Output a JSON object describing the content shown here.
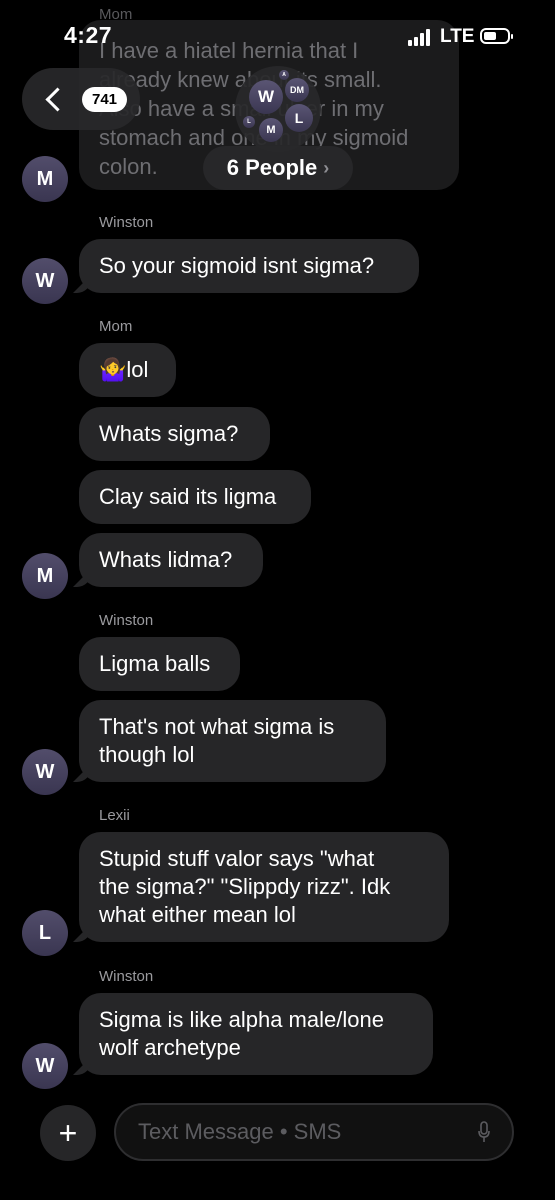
{
  "status_bar": {
    "time": "4:27",
    "network": "LTE"
  },
  "header": {
    "back_badge": "741",
    "group_avatars": [
      "W",
      "DM",
      "L",
      "M",
      "L",
      "A"
    ],
    "people_label": "6 People",
    "people_chevron": "›"
  },
  "previous_message": {
    "sender": "Mom",
    "lines": [
      "I have a hiatel hernia that I",
      "already knew about its small.",
      "Also have a small ulcer in my",
      "stomach and one in my sigmoid",
      "colon."
    ]
  },
  "messages": [
    {
      "sender": "Winston",
      "avatar": "W",
      "text": "So your sigmoid isnt sigma?"
    },
    {
      "sender": "Mom",
      "text": "🤷‍♀️lol"
    },
    {
      "text": "Whats sigma?"
    },
    {
      "text": "Clay said its ligma"
    },
    {
      "avatar": "M",
      "text": "Whats lidma?"
    },
    {
      "sender": "Winston",
      "text": "Ligma balls"
    },
    {
      "avatar": "W",
      "text_lines": [
        "That's not what sigma is",
        "though lol"
      ]
    },
    {
      "sender": "Lexii",
      "avatar": "L",
      "text_lines": [
        "Stupid stuff valor says \"what",
        "the sigma?\" \"Slippdy rizz\". Idk",
        "what either mean lol"
      ]
    },
    {
      "sender": "Winston",
      "avatar": "W",
      "text_lines": [
        "Sigma is like alpha male/lone",
        "wolf archetype"
      ]
    }
  ],
  "top_avatar": "M",
  "input": {
    "placeholder": "Text Message • SMS",
    "plus": "+"
  }
}
